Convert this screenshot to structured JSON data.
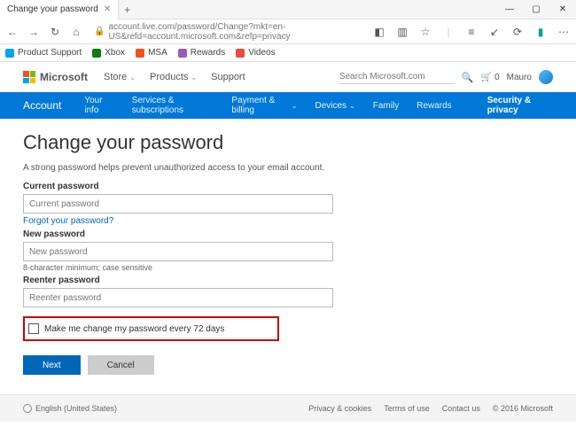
{
  "browser": {
    "tab_title": "Change your password",
    "url": "account.live.com/password/Change?mkt=en-US&refd=account.microsoft.com&refp=privacy",
    "win_min": "—",
    "win_max": "▢",
    "win_close": "✕",
    "newtab": "+",
    "favorites": [
      {
        "label": "Product Support",
        "color": "#00a4ef"
      },
      {
        "label": "Xbox",
        "color": "#107c10"
      },
      {
        "label": "MSA",
        "color": "#f25022"
      },
      {
        "label": "Rewards",
        "color": "#9b59b6"
      },
      {
        "label": "Videos",
        "color": "#e74c3c"
      }
    ]
  },
  "header": {
    "logo_text": "Microsoft",
    "nav": [
      {
        "label": "Store",
        "caret": true
      },
      {
        "label": "Products",
        "caret": true
      },
      {
        "label": "Support",
        "caret": false
      }
    ],
    "search_placeholder": "Search Microsoft.com",
    "cart_count": "0",
    "username": "Mauro"
  },
  "bluenav": {
    "account": "Account",
    "items_left": [
      {
        "label": "Your info",
        "caret": false
      },
      {
        "label": "Services & subscriptions",
        "caret": false
      },
      {
        "label": "Payment & billing",
        "caret": true
      },
      {
        "label": "Devices",
        "caret": true
      },
      {
        "label": "Family",
        "caret": false
      },
      {
        "label": "Rewards",
        "caret": false
      }
    ],
    "active": "Security & privacy"
  },
  "page": {
    "title": "Change your password",
    "subtitle": "A strong password helps prevent unauthorized access to your email account.",
    "current_label": "Current password",
    "current_placeholder": "Current password",
    "forgot": "Forgot your password?",
    "new_label": "New password",
    "new_placeholder": "New password",
    "hint": "8-character minimum; case sensitive",
    "reenter_label": "Reenter password",
    "reenter_placeholder": "Reenter password",
    "checkbox_label": "Make me change my password every 72 days",
    "next": "Next",
    "cancel": "Cancel"
  },
  "footer": {
    "locale": "English (United States)",
    "links": [
      "Privacy & cookies",
      "Terms of use",
      "Contact us"
    ],
    "copyright": "© 2016 Microsoft"
  }
}
